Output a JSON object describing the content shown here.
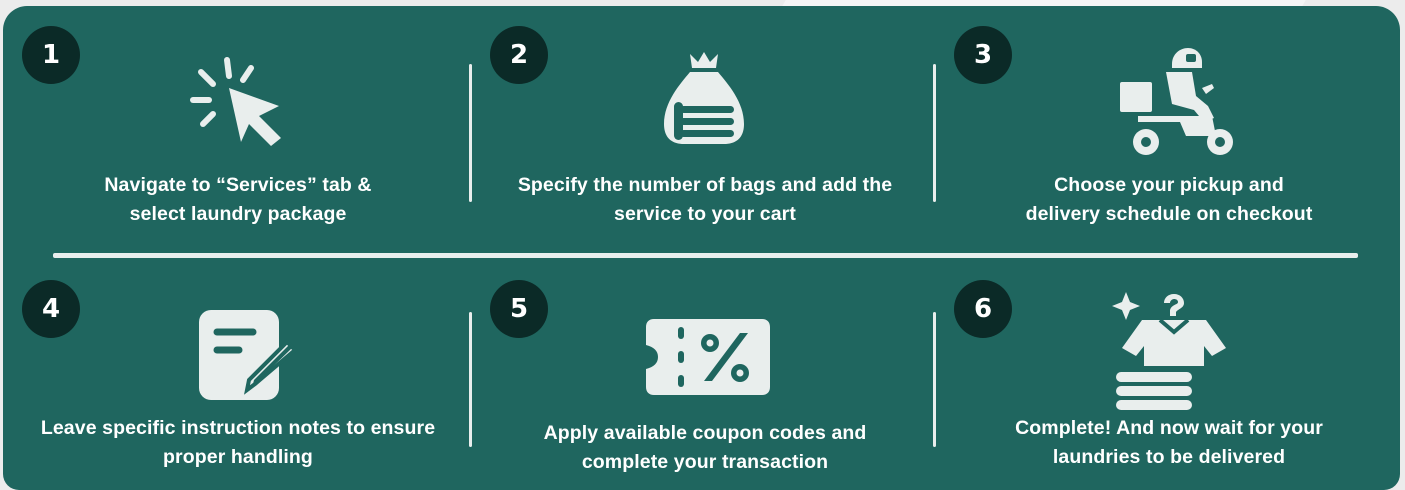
{
  "steps": [
    {
      "number": "1",
      "icon": "click-cursor-icon",
      "lines": [
        "Navigate to “Services” tab &",
        "select laundry package"
      ]
    },
    {
      "number": "2",
      "icon": "laundry-bag-icon",
      "lines": [
        "Specify the number of bags and add the",
        "service to your cart"
      ]
    },
    {
      "number": "3",
      "icon": "delivery-scooter-icon",
      "lines": [
        "Choose your pickup and",
        "delivery schedule on checkout"
      ]
    },
    {
      "number": "4",
      "icon": "edit-notes-icon",
      "lines": [
        "Leave specific instruction notes to ensure",
        "proper handling"
      ]
    },
    {
      "number": "5",
      "icon": "coupon-percent-icon",
      "lines": [
        "Apply available coupon codes and",
        "complete your transaction"
      ]
    },
    {
      "number": "6",
      "icon": "clean-laundry-icon",
      "lines": [
        "Complete! And now wait for your",
        "laundries to be delivered"
      ]
    }
  ],
  "colors": {
    "panel": "#1f665f",
    "badge": "#0b2a27",
    "icon": "#e9eeed",
    "text": "#ffffff",
    "background": "#ececec"
  }
}
